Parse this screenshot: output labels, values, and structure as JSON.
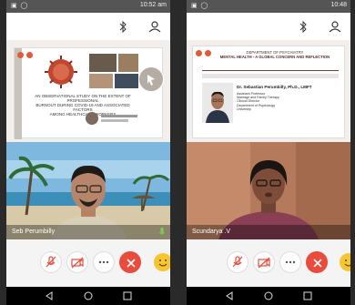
{
  "left_phone": {
    "status_time": "10:52 am",
    "participant_name": "Seb Perumbilly",
    "slide": {
      "title_lines": [
        "AN OBSERVATIONAL STUDY ON THE EXTENT OF PROFESSIONAL",
        "BURNOUT DURING COVID-19 AND ASSOCIATED FACTORS",
        "AMONG HEALTHCARE WORKERS"
      ]
    }
  },
  "right_phone": {
    "status_time": "10:48",
    "participant_name": "Scundarya .V",
    "document": {
      "header_lines": [
        "DEPARTMENT OF PSYCHIATRY",
        "MENTAL HEALTH - A GLOBAL CONCERN AND REFLECTION"
      ],
      "speaker_name": "Dr. Sebastian Perumbilly, Ph.D., LMFT",
      "speaker_info": [
        "Assistant Professor",
        "Marriage and Family Therapy",
        "Clinical Director",
        "Department of Psychology",
        "University"
      ]
    }
  },
  "icons": {
    "bluetooth": "bluetooth-icon",
    "person": "person-icon",
    "mic_off": "mic-off-icon",
    "video_off": "video-off-icon",
    "more": "more-icon",
    "end_call": "end-call-icon",
    "reaction": "emoji-icon",
    "back": "back-icon",
    "home": "home-icon",
    "recent": "recent-apps-icon"
  },
  "colors": {
    "end_call": "#e94b3c",
    "status_bar": "#555555",
    "nav_bar": "#000000"
  }
}
